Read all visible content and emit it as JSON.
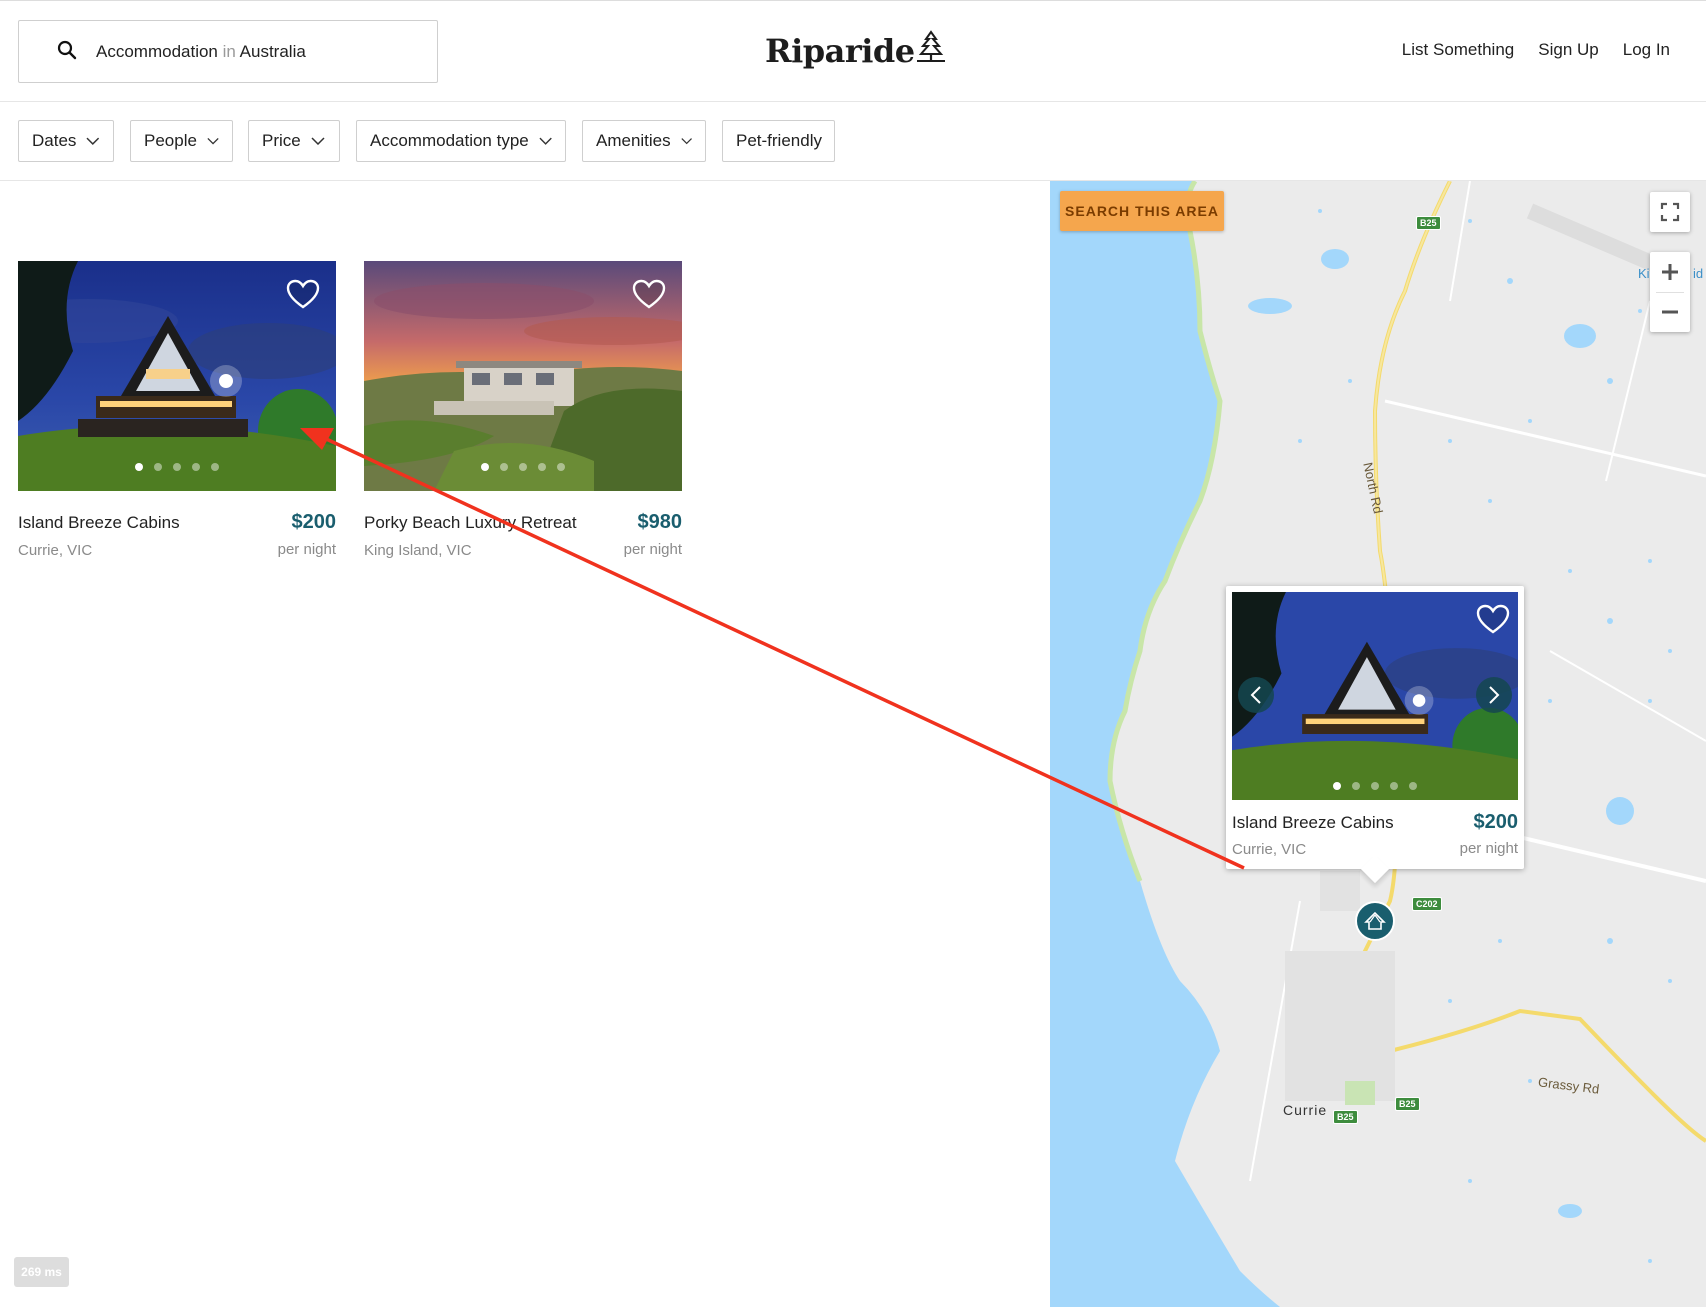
{
  "search": {
    "what": "Accommodation",
    "connector": "in",
    "where": "Australia"
  },
  "brand": {
    "name": "Riparide"
  },
  "nav": {
    "list_something": "List Something",
    "sign_up": "Sign Up",
    "log_in": "Log In"
  },
  "filters": [
    {
      "label": "Dates",
      "dropdown": true
    },
    {
      "label": "People",
      "dropdown": true
    },
    {
      "label": "Price",
      "dropdown": true
    },
    {
      "label": "Accommodation type",
      "dropdown": true
    },
    {
      "label": "Amenities",
      "dropdown": true
    },
    {
      "label": "Pet-friendly",
      "dropdown": false
    }
  ],
  "listings": [
    {
      "title": "Island Breeze Cabins",
      "location": "Currie, VIC",
      "price": "$200",
      "unit": "per night",
      "photo_count": 5,
      "active_photo": 1
    },
    {
      "title": "Porky Beach Luxury Retreat",
      "location": "King Island, VIC",
      "price": "$980",
      "unit": "per night",
      "photo_count": 5,
      "active_photo": 1
    }
  ],
  "map": {
    "search_area": "SEARCH THIS AREA",
    "labels": {
      "north_rd": "North Rd",
      "currie": "Currie",
      "grassy_rd": "Grassy Rd",
      "ki": "Ki",
      "id": "id"
    },
    "shields": {
      "b25_top": "B25",
      "c202": "C202",
      "b25_mid": "B25",
      "b25_town": "B25"
    },
    "popup": {
      "title": "Island Breeze Cabins",
      "location": "Currie, VIC",
      "price": "$200",
      "unit": "per night",
      "photo_count": 5,
      "active_photo": 1
    }
  },
  "debug": {
    "timing": "269 ms"
  },
  "colors": {
    "price": "#1a5e6e",
    "accent_button": "#f5a64d",
    "annotation_arrow": "#f0321e",
    "water": "#a3d7fb",
    "land": "#ebebeb"
  },
  "icons": {
    "search": "search-icon",
    "heart": "heart-icon",
    "chevron": "chevron-down-icon",
    "pin": "cabin-pin-icon"
  }
}
